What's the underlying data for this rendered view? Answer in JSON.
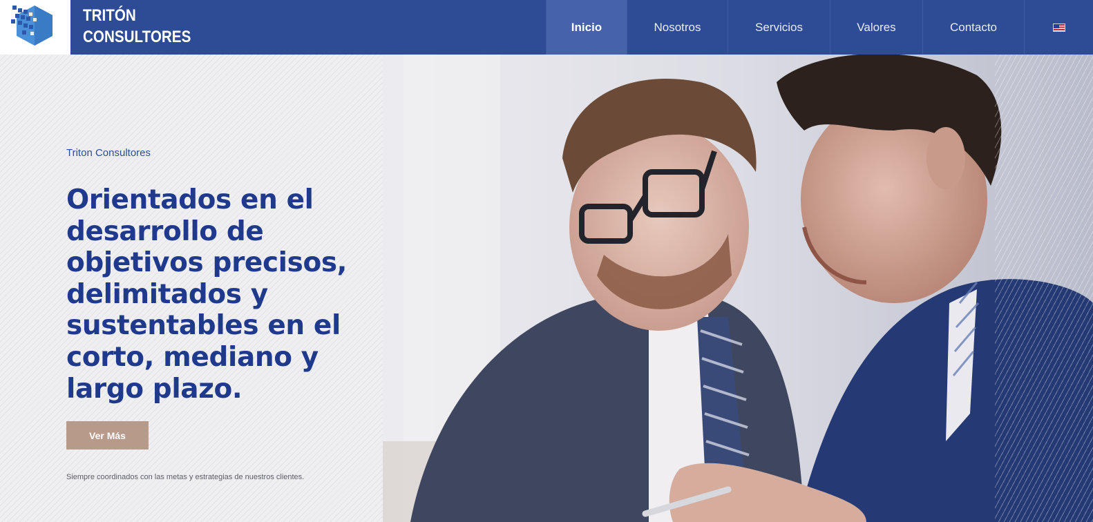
{
  "brand": {
    "line1": "TRITÓN",
    "line2": "CONSULTORES",
    "logo_icon": "hexagon-pixel-logo"
  },
  "nav": {
    "items": [
      {
        "label": "Inicio",
        "active": true
      },
      {
        "label": "Nosotros",
        "active": false
      },
      {
        "label": "Servicios",
        "active": false
      },
      {
        "label": "Valores",
        "active": false
      },
      {
        "label": "Contacto",
        "active": false
      }
    ],
    "language_icon": "us-flag-icon"
  },
  "hero": {
    "eyebrow": "Triton Consultores",
    "headline": "Orientados en el desarrollo de objetivos precisos, delimitados y sustentables en el corto, mediano y largo plazo.",
    "cta_label": "Ver Más",
    "tagline": "Siempre coordinados con las metas y estrategias de nuestros clientes."
  },
  "colors": {
    "header_bg": "#2e4b96",
    "active_nav_bg": "#4662a8",
    "headline": "#1f3a8c",
    "cta_bg": "#b89a8b"
  }
}
